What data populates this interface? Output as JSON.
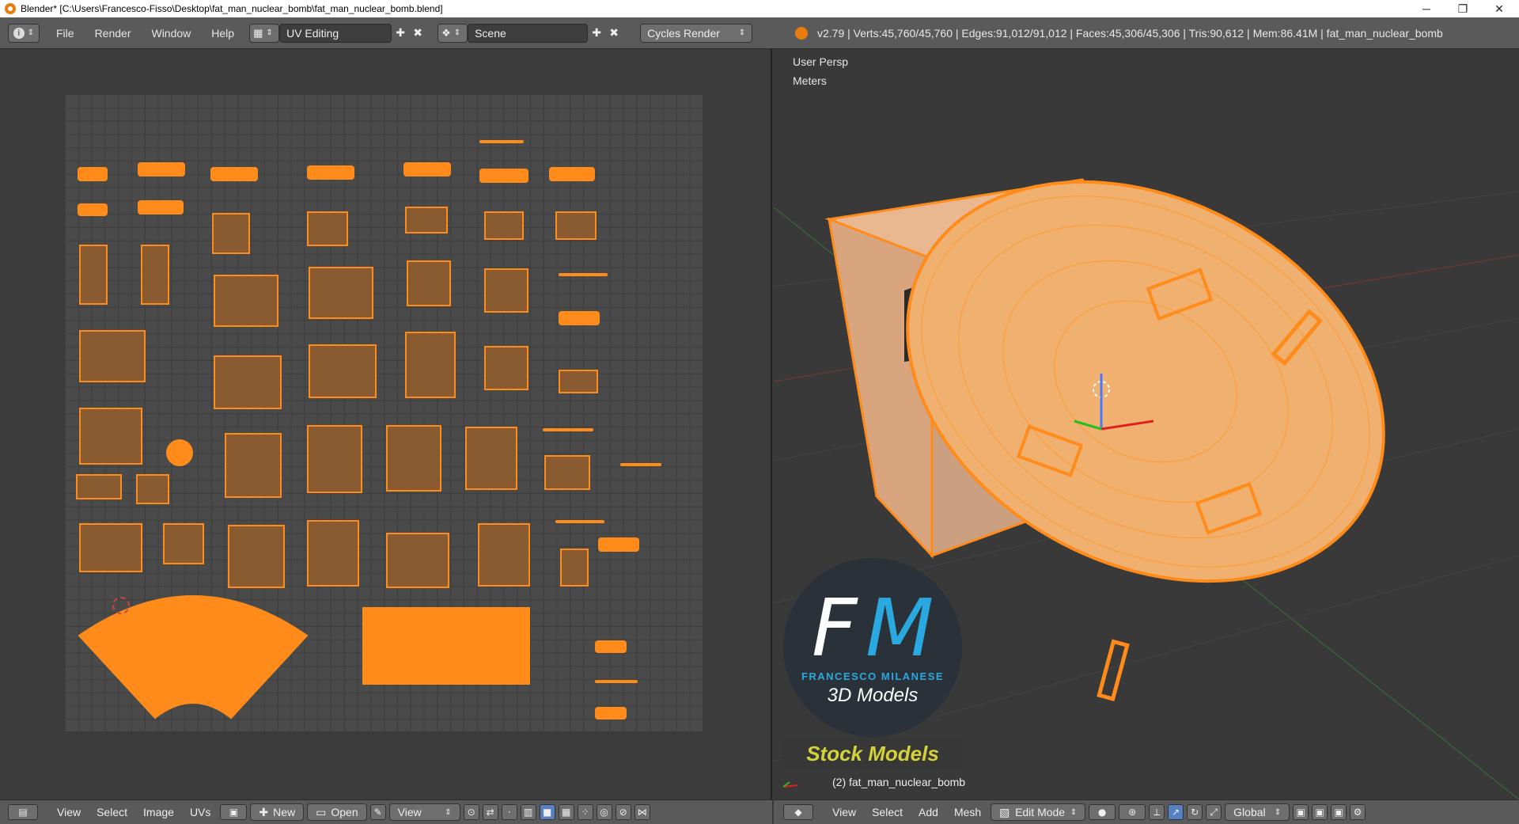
{
  "window": {
    "title": "Blender* [C:\\Users\\Francesco-Fisso\\Desktop\\fat_man_nuclear_bomb\\fat_man_nuclear_bomb.blend]",
    "min_glyph": "─",
    "max_glyph": "❐",
    "close_glyph": "✕"
  },
  "topbar": {
    "menus": [
      "File",
      "Render",
      "Window",
      "Help"
    ],
    "screen_layout": "UV Editing",
    "scene": "Scene",
    "render_engine": "Cycles Render",
    "stats": "v2.79 | Verts:45,760/45,760 | Edges:91,012/91,012 | Faces:45,306/45,306 | Tris:90,612 | Mem:86.41M | fat_man_nuclear_bomb"
  },
  "viewport": {
    "view_name": "User Persp",
    "units": "Meters",
    "object_label": "(2) fat_man_nuclear_bomb"
  },
  "watermark": {
    "letter_f": "F",
    "letter_m": "M",
    "name": "FRANCESCO MILANESE",
    "subtitle": "3D Models",
    "stock": "Stock Models",
    "color_accent": "#2aa8e0",
    "color_stock": "#d4d23a"
  },
  "uv_footer": {
    "menus": [
      "View",
      "Select",
      "Image",
      "UVs"
    ],
    "new_label": "New",
    "open_label": "Open",
    "view_label": "View"
  },
  "vp_footer": {
    "menus": [
      "View",
      "Select",
      "Add",
      "Mesh"
    ],
    "mode": "Edit Mode",
    "orientation": "Global"
  },
  "colors": {
    "selection": "#ff8c1a",
    "header": "#5a5a5a",
    "background": "#393939"
  }
}
